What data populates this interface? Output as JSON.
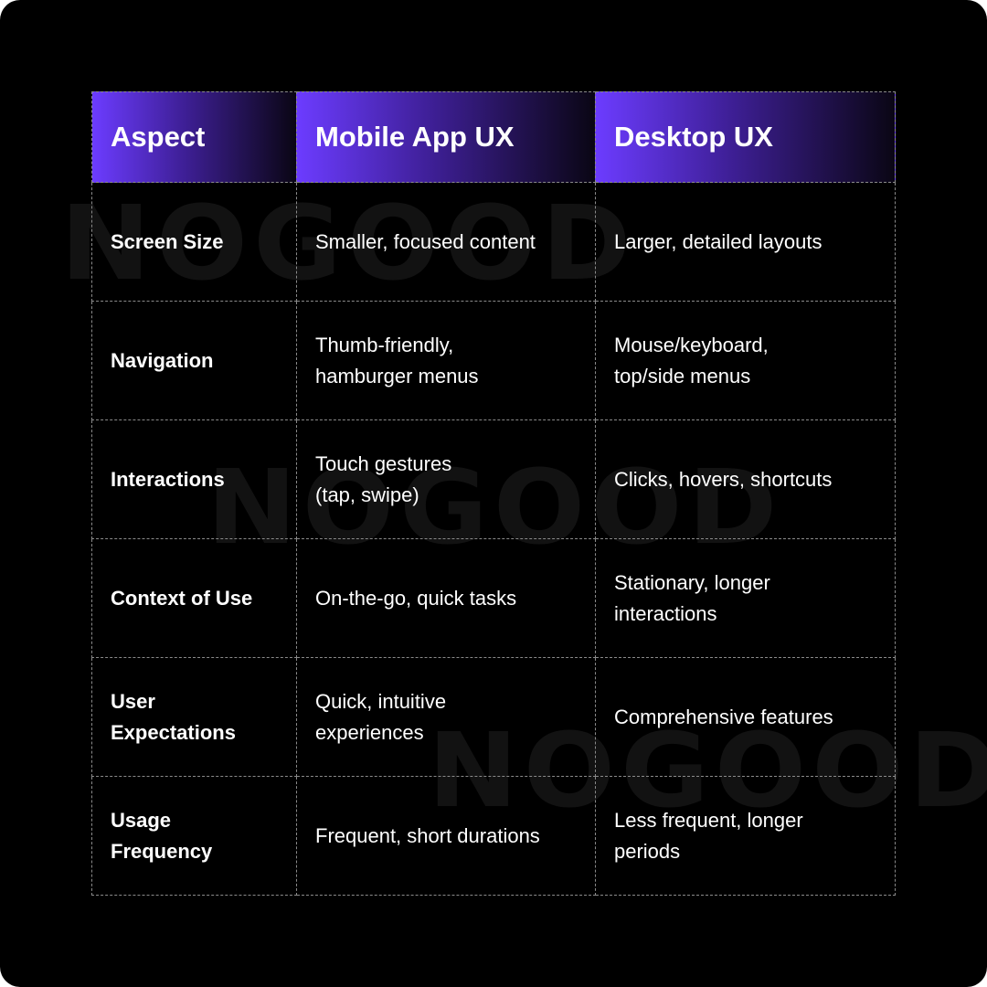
{
  "watermark": {
    "text": "NOGOOD"
  },
  "colors": {
    "accent": "#6c3cff",
    "background": "#000000",
    "border": "#8a8a8a",
    "text": "#ffffff"
  },
  "table": {
    "headers": [
      "Aspect",
      "Mobile App UX",
      "Desktop UX"
    ],
    "rows": [
      {
        "aspect": "Screen Size",
        "mobile": "Smaller, focused content",
        "desktop": "Larger, detailed layouts"
      },
      {
        "aspect": "Navigation",
        "mobile": "Thumb-friendly, hamburger menus",
        "desktop": "Mouse/keyboard, top/side menus"
      },
      {
        "aspect": "Interactions",
        "mobile": "Touch gestures (tap, swipe)",
        "desktop": "Clicks, hovers, shortcuts"
      },
      {
        "aspect": "Context of Use",
        "mobile": "On-the-go, quick tasks",
        "desktop": "Stationary, longer interactions"
      },
      {
        "aspect": "User Expectations",
        "mobile": "Quick, intuitive experiences",
        "desktop": "Comprehensive features"
      },
      {
        "aspect": "Usage Frequency",
        "mobile": "Frequent, short durations",
        "desktop": "Less frequent, longer periods"
      }
    ]
  }
}
